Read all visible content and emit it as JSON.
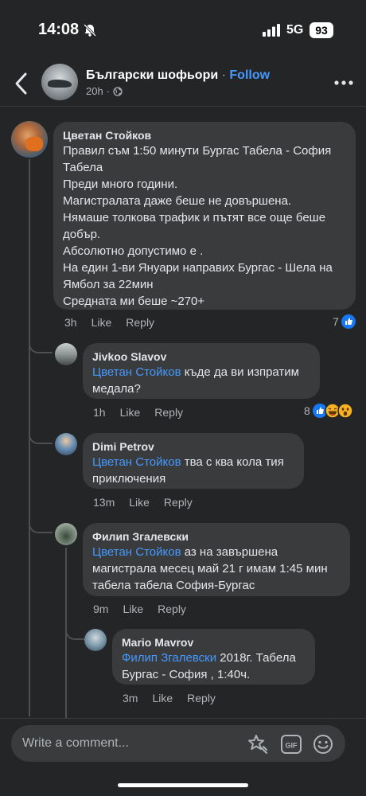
{
  "status": {
    "time": "14:08",
    "network": "5G",
    "battery": "93"
  },
  "header": {
    "group_name": "Български шофьори",
    "separator": " · ",
    "follow_label": "Follow",
    "age": "20h"
  },
  "comments": [
    {
      "author": "Цветан Стойков",
      "lines": [
        "Правил съм 1:50 минути Бургас Табела - София",
        "Табела",
        "Преди много години.",
        "Магистралата даже беше не довършена.",
        "Нямаше толкова трафик и пътят все още беше",
        "добър.",
        "Абсолютно допустимо е .",
        "На един 1-ви Януари направих Бургас - Шела на",
        "Ямбол за 22мин",
        "Средната ми беше ~270+"
      ],
      "age": "3h",
      "like": "Like",
      "reply": "Reply",
      "reaction_count": "7"
    },
    {
      "author": "Jivkoo Slavov",
      "mention": "Цветан Стойков",
      "text1": " къде да ви изпратим",
      "text2": "медала?",
      "age": "1h",
      "like": "Like",
      "reply": "Reply",
      "reaction_count": "8"
    },
    {
      "author": "Dimi Petrov",
      "mention": "Цветан Стойков",
      "text1": " тва с ква кола тия",
      "text2": "приключения",
      "age": "13m",
      "like": "Like",
      "reply": "Reply"
    },
    {
      "author": "Филип Згалевски",
      "mention": "Цветан Стойков",
      "text1": " аз на завършена",
      "text2": "магистрала месец май 21 г имам 1:45 мин",
      "text3": "табела табела София-Бургас",
      "age": "9m",
      "like": "Like",
      "reply": "Reply"
    },
    {
      "author": "Mario Mavrov",
      "mention": "Филип Згалевски",
      "text1": " 2018г. Табела",
      "text2": "Бургас - София , 1:40ч.",
      "age": "3m",
      "like": "Like",
      "reply": "Reply"
    }
  ],
  "composer": {
    "placeholder": "Write a comment...",
    "gif_label": "GIF"
  },
  "colors": {
    "background": "#242526",
    "bubble": "#3a3b3c",
    "link": "#4599ff",
    "muted": "#b0b3b8"
  }
}
